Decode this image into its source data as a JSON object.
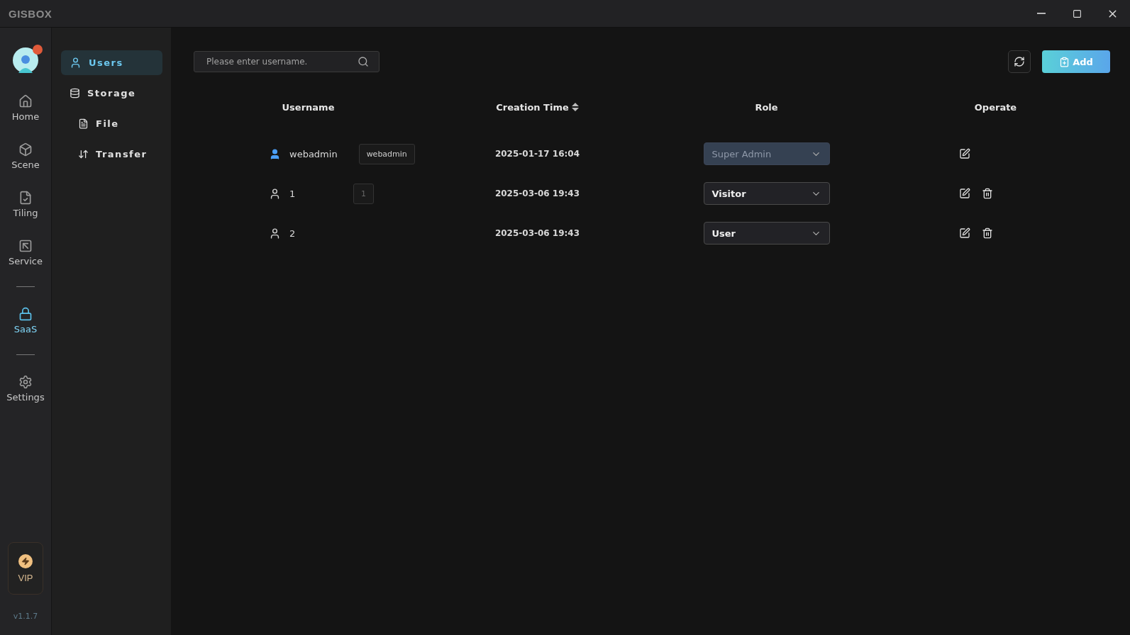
{
  "window": {
    "title": "GISBOX"
  },
  "rail": {
    "groups": [
      [
        {
          "label": "Home",
          "selected": false
        },
        {
          "label": "Scene",
          "selected": false
        },
        {
          "label": "Tiling",
          "selected": false
        },
        {
          "label": "Service",
          "selected": false
        }
      ],
      [
        {
          "label": "SaaS",
          "selected": true
        }
      ],
      [
        {
          "label": "Settings",
          "selected": false
        }
      ]
    ],
    "vip": "VIP",
    "version": "v1.1.7"
  },
  "submenu": [
    {
      "label": "Users",
      "selected": true
    },
    {
      "label": "Storage",
      "selected": false,
      "children": [
        {
          "label": "File",
          "selected": false
        },
        {
          "label": "Transfer",
          "selected": false
        }
      ]
    }
  ],
  "search": {
    "placeholder": "Please enter username."
  },
  "add_button": "Add",
  "table": {
    "columns": [
      {
        "label": "Username",
        "sortable": false
      },
      {
        "label": "Creation Time",
        "sortable": true
      },
      {
        "label": "Role",
        "sortable": false
      },
      {
        "label": "Operate",
        "sortable": false
      }
    ],
    "rows": [
      {
        "username": "webadmin",
        "highlighted": true,
        "tooltip": "webadmin",
        "tooltip_dim": false,
        "created": "2025-01-17 16:04",
        "role": "Super Admin",
        "role_disabled": true,
        "deletable": false
      },
      {
        "username": "1",
        "highlighted": false,
        "tooltip": "1",
        "tooltip_dim": true,
        "created": "2025-03-06 19:43",
        "role": "Visitor",
        "role_disabled": false,
        "deletable": true
      },
      {
        "username": "2",
        "highlighted": false,
        "created": "2025-03-06 19:43",
        "role": "User",
        "role_disabled": false,
        "deletable": true
      }
    ]
  }
}
